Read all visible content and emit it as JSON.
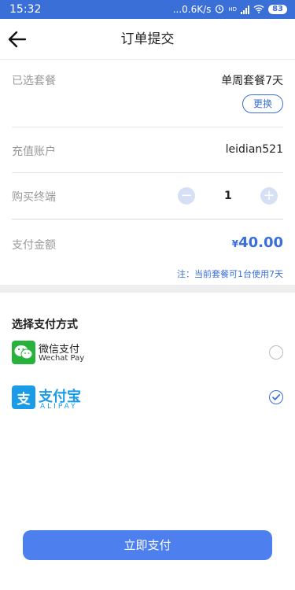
{
  "status_bar": {
    "time": "15:32",
    "network_speed": "...0.6K/s",
    "battery": "83",
    "hd_label": "HD",
    "icons": [
      "alarm-icon",
      "hd-icon",
      "signal-icon",
      "wifi-icon",
      "battery-icon"
    ]
  },
  "header": {
    "back_icon": "arrow-left-icon",
    "title": "订单提交"
  },
  "order": {
    "package_label": "已选套餐",
    "package_value": "单周套餐7天",
    "change_button": "更换",
    "account_label": "充值账户",
    "account_value": "leidian521",
    "terminal_label": "购买终端",
    "quantity": "1",
    "minus_symbol": "−",
    "plus_symbol": "+",
    "amount_label": "支付金额",
    "amount_currency": "¥",
    "amount_value": "40.00",
    "note": "注：当前套餐可1台使用7天"
  },
  "payment": {
    "section_title": "选择支付方式",
    "options": [
      {
        "name": "微信支付",
        "sub": "Wechat Pay",
        "icon": "wechat-icon",
        "selected": false
      },
      {
        "name": "支付宝",
        "sub": "ALIPAY",
        "icon": "alipay-icon",
        "glyph": "支",
        "selected": true
      }
    ]
  },
  "actions": {
    "pay_button": "立即支付"
  },
  "colors": {
    "accent": "#3b6fd8",
    "button": "#4d80ee",
    "wechat": "#27b33b",
    "alipay": "#1a9be8"
  }
}
